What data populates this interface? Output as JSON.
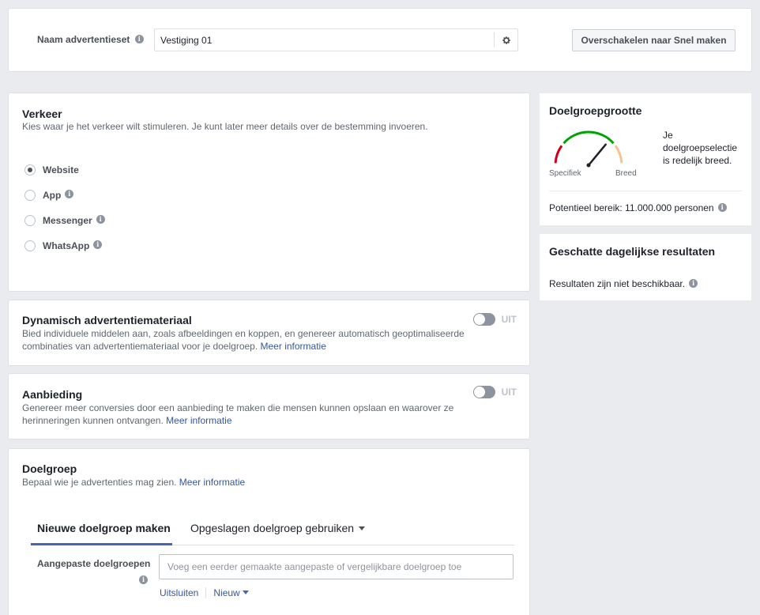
{
  "header": {
    "name_label": "Naam advertentieset",
    "name_value": "Vestiging 01",
    "switch_button": "Overschakelen naar Snel maken"
  },
  "traffic": {
    "title": "Verkeer",
    "description": "Kies waar je het verkeer wilt stimuleren. Je kunt later meer details over de bestemming invoeren.",
    "options": [
      {
        "label": "Website",
        "selected": true
      },
      {
        "label": "App",
        "selected": false
      },
      {
        "label": "Messenger",
        "selected": false
      },
      {
        "label": "WhatsApp",
        "selected": false
      }
    ]
  },
  "dynamic": {
    "title": "Dynamisch advertentiemateriaal",
    "description": "Bied individuele middelen aan, zoals afbeeldingen en koppen, en genereer automatisch geoptimaliseerde combinaties van advertentiemateriaal voor je doelgroep.",
    "link": "Meer informatie",
    "toggle_label": "UIT"
  },
  "offer": {
    "title": "Aanbieding",
    "description": "Genereer meer conversies door een aanbieding te maken die mensen kunnen opslaan en waarover ze herinneringen kunnen ontvangen.",
    "link": "Meer informatie",
    "toggle_label": "UIT"
  },
  "audience": {
    "title": "Doelgroep",
    "description": "Bepaal wie je advertenties mag zien.",
    "link": "Meer informatie",
    "tabs": [
      "Nieuwe doelgroep maken",
      "Opgeslagen doelgroep gebruiken"
    ],
    "custom_label": "Aangepaste doelgroepen",
    "custom_placeholder": "Voeg een eerder gemaakte aangepaste of vergelijkbare doelgroep toe",
    "exclude_link": "Uitsluiten",
    "new_link": "Nieuw"
  },
  "audience_size": {
    "title": "Doelgroepgrootte",
    "gauge_left": "Specifiek",
    "gauge_right": "Breed",
    "gauge_level": 0.72,
    "description": "Je doelgroepselectie is redelijk breed.",
    "reach": "Potentieel bereik: 11.000.000 personen",
    "colors": {
      "specific": "#d0021b",
      "good": "#00a400",
      "broad": "#f7c28c",
      "needle": "#1d2129"
    }
  },
  "daily_results": {
    "title": "Geschatte dagelijkse resultaten",
    "text": "Resultaten zijn niet beschikbaar."
  },
  "colors": {
    "accent": "#4267b2",
    "link": "#365899",
    "background": "#e9ebee"
  }
}
